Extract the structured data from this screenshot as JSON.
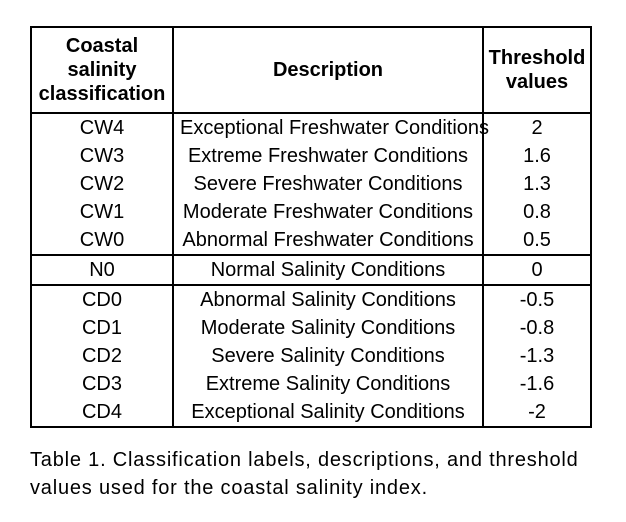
{
  "table": {
    "headers": {
      "col1": "Coastal salinity classification",
      "col2": "Description",
      "col3": "Threshold values"
    },
    "groups": [
      {
        "rows": [
          {
            "code": "CW4",
            "desc": "Exceptional Freshwater Conditions",
            "thr": "2"
          },
          {
            "code": "CW3",
            "desc": "Extreme Freshwater Conditions",
            "thr": "1.6"
          },
          {
            "code": "CW2",
            "desc": "Severe Freshwater Conditions",
            "thr": "1.3"
          },
          {
            "code": "CW1",
            "desc": "Moderate Freshwater Conditions",
            "thr": "0.8"
          },
          {
            "code": "CW0",
            "desc": "Abnormal Freshwater Conditions",
            "thr": "0.5"
          }
        ]
      },
      {
        "rows": [
          {
            "code": "N0",
            "desc": "Normal Salinity Conditions",
            "thr": "0"
          }
        ]
      },
      {
        "rows": [
          {
            "code": "CD0",
            "desc": "Abnormal Salinity Conditions",
            "thr": "-0.5"
          },
          {
            "code": "CD1",
            "desc": "Moderate Salinity Conditions",
            "thr": "-0.8"
          },
          {
            "code": "CD2",
            "desc": "Severe Salinity Conditions",
            "thr": "-1.3"
          },
          {
            "code": "CD3",
            "desc": "Extreme Salinity Conditions",
            "thr": "-1.6"
          },
          {
            "code": "CD4",
            "desc": "Exceptional Salinity Conditions",
            "thr": "-2"
          }
        ]
      }
    ]
  },
  "caption": "Table 1. Classification labels, descriptions, and threshold values used for the coastal salinity index."
}
